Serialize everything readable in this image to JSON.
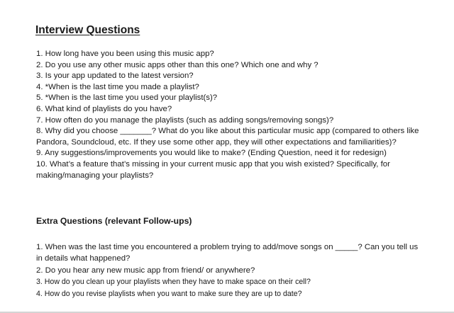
{
  "document": {
    "title": "Interview Questions",
    "questions": [
      "1. How long have you been using this music app?",
      "2. Do you use any other music apps other than this one? Which one and why ?",
      "3. Is your app updated to the latest version?",
      "4. *When is the last time you made a playlist?",
      "5. *When is the last time you used your playlist(s)?",
      "6. What kind of playlists do you have?",
      "7. How often do you manage the playlists (such as adding songs/removing songs)?",
      "8. Why did you choose _______? What do you like about this particular music app (compared to others like Pandora, Soundcloud, etc. If they use some other app, they will other expectations and familiarities)?",
      "9. Any suggestions/improvements you would like to make? (Ending Question, need it for redesign)",
      "10. What’s a feature that’s missing in your current music app that you wish existed? Specifically, for making/managing your playlists?"
    ],
    "extra_heading": "Extra Questions (relevant Follow-ups)",
    "extra_questions": [
      "1. When was the last time you encountered a problem trying to add/move songs on _____? Can you tell us in details what happened?",
      "2. Do you hear any new music app from friend/ or anywhere?",
      "3. How do you clean up your playlists when they have to make space on their cell?",
      "4. How do you revise playlists when you want to make sure they are up to date?"
    ]
  }
}
